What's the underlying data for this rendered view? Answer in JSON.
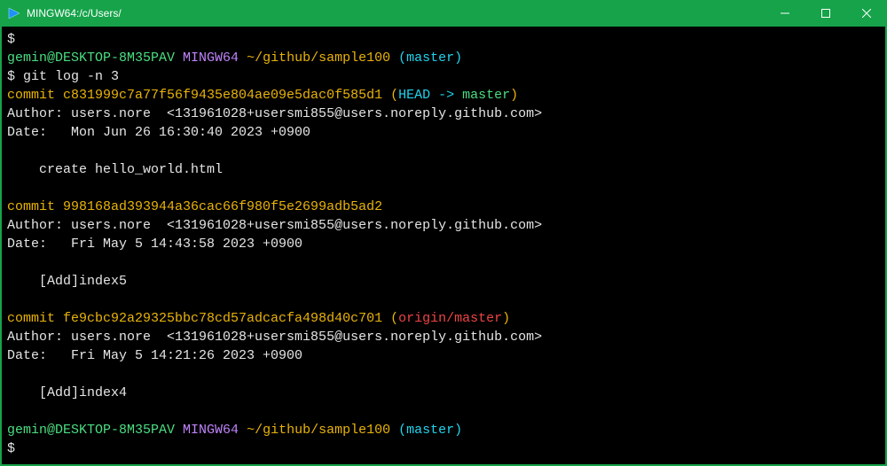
{
  "titlebar": {
    "title": "MINGW64:/c/Users/"
  },
  "terminal": {
    "prompt": {
      "dollar": "$",
      "userhost": "gemin@DESKTOP-8M35PAV",
      "env": "MINGW64",
      "path": "~/github/sample100",
      "branch": "(master)"
    },
    "cmd1": "git log -n 3",
    "commits": [
      {
        "hash": "c831999c7a77f56f9435e804ae09e5dac0f585d1",
        "refs": "(HEAD -> master)",
        "head_text": "HEAD -> ",
        "head_branch": "master",
        "author_label": "Author: ",
        "author": "users.nore  <131961028+usersmi855@users.noreply.github.com>",
        "date_label": "Date:   ",
        "date": "Mon Jun 26 16:30:40 2023 +0900",
        "msg": "    create hello_world.html"
      },
      {
        "hash": "998168ad393944a36cac66f980f5e2699adb5ad2",
        "author_label": "Author: ",
        "author": "users.nore  <131961028+usersmi855@users.noreply.github.com>",
        "date_label": "Date:   ",
        "date": "Fri May 5 14:43:58 2023 +0900",
        "msg": "    [Add]index5"
      },
      {
        "hash": "fe9cbc92a29325bbc78cd57adcacfa498d40c701",
        "refs": "(origin/master)",
        "refs_text": "origin/master",
        "author_label": "Author: ",
        "author": "users.nore  <131961028+usersmi855@users.noreply.github.com>",
        "date_label": "Date:   ",
        "date": "Fri May 5 14:21:26 2023 +0900",
        "msg": "    [Add]index4"
      }
    ],
    "labels": {
      "commit": "commit "
    }
  }
}
